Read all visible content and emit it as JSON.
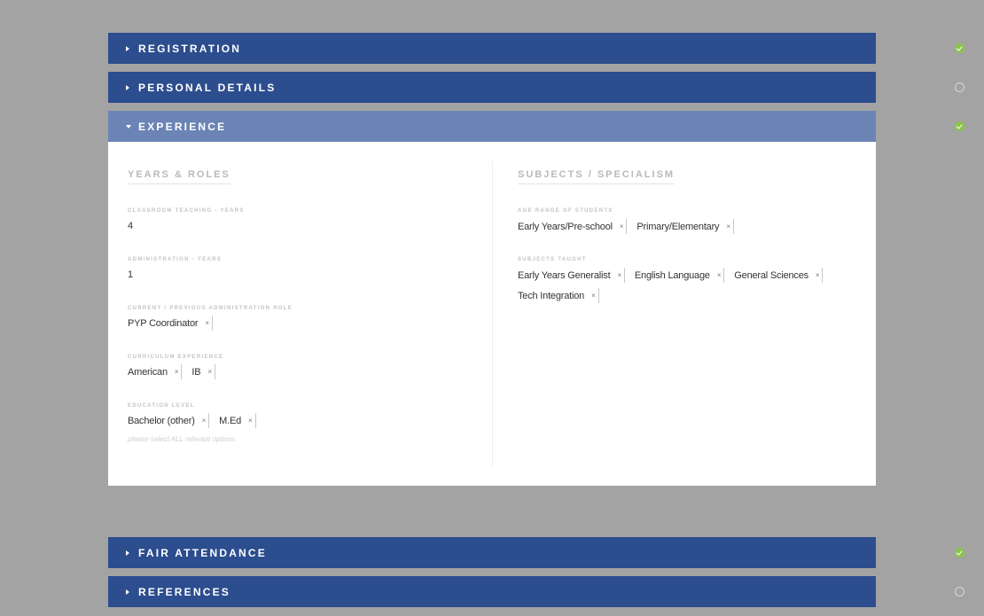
{
  "sections": {
    "registration": {
      "title": "REGISTRATION",
      "status": "complete"
    },
    "personal_details": {
      "title": "PERSONAL DETAILS",
      "status": "incomplete"
    },
    "experience": {
      "title": "EXPERIENCE",
      "status": "complete"
    },
    "fair_attendance": {
      "title": "FAIR ATTENDANCE",
      "status": "complete"
    },
    "references": {
      "title": "REFERENCES",
      "status": "incomplete"
    }
  },
  "experience": {
    "years_roles": {
      "heading": "YEARS & ROLES",
      "classroom_label": "CLASSROOM TEACHING - YEARS",
      "classroom_value": "4",
      "admin_label": "ADMINISTRATION - YEARS",
      "admin_value": "1",
      "role_label": "CURRENT / PREVIOUS ADMINISTRATION ROLE",
      "role_tags": [
        "PYP Coordinator"
      ],
      "curriculum_label": "CURRICULUM EXPERIENCE",
      "curriculum_tags": [
        "American",
        "IB"
      ],
      "education_label": "EDUCATION LEVEL",
      "education_tags": [
        "Bachelor (other)",
        "M.Ed"
      ],
      "education_hint": "please select ALL relevant options"
    },
    "subjects": {
      "heading": "SUBJECTS / SPECIALISM",
      "age_label": "AGE RANGE OF STUDENTS",
      "age_tags": [
        "Early Years/Pre-school",
        "Primary/Elementary"
      ],
      "taught_label": "SUBJECTS TAUGHT",
      "taught_tags": [
        "Early Years Generalist",
        "English Language",
        "General Sciences",
        "Tech Integration"
      ]
    }
  },
  "tag_remove_glyph": "×",
  "colors": {
    "header": "#2c4d8e",
    "header_open": "#6b84b5",
    "complete": "#8bc34a"
  }
}
